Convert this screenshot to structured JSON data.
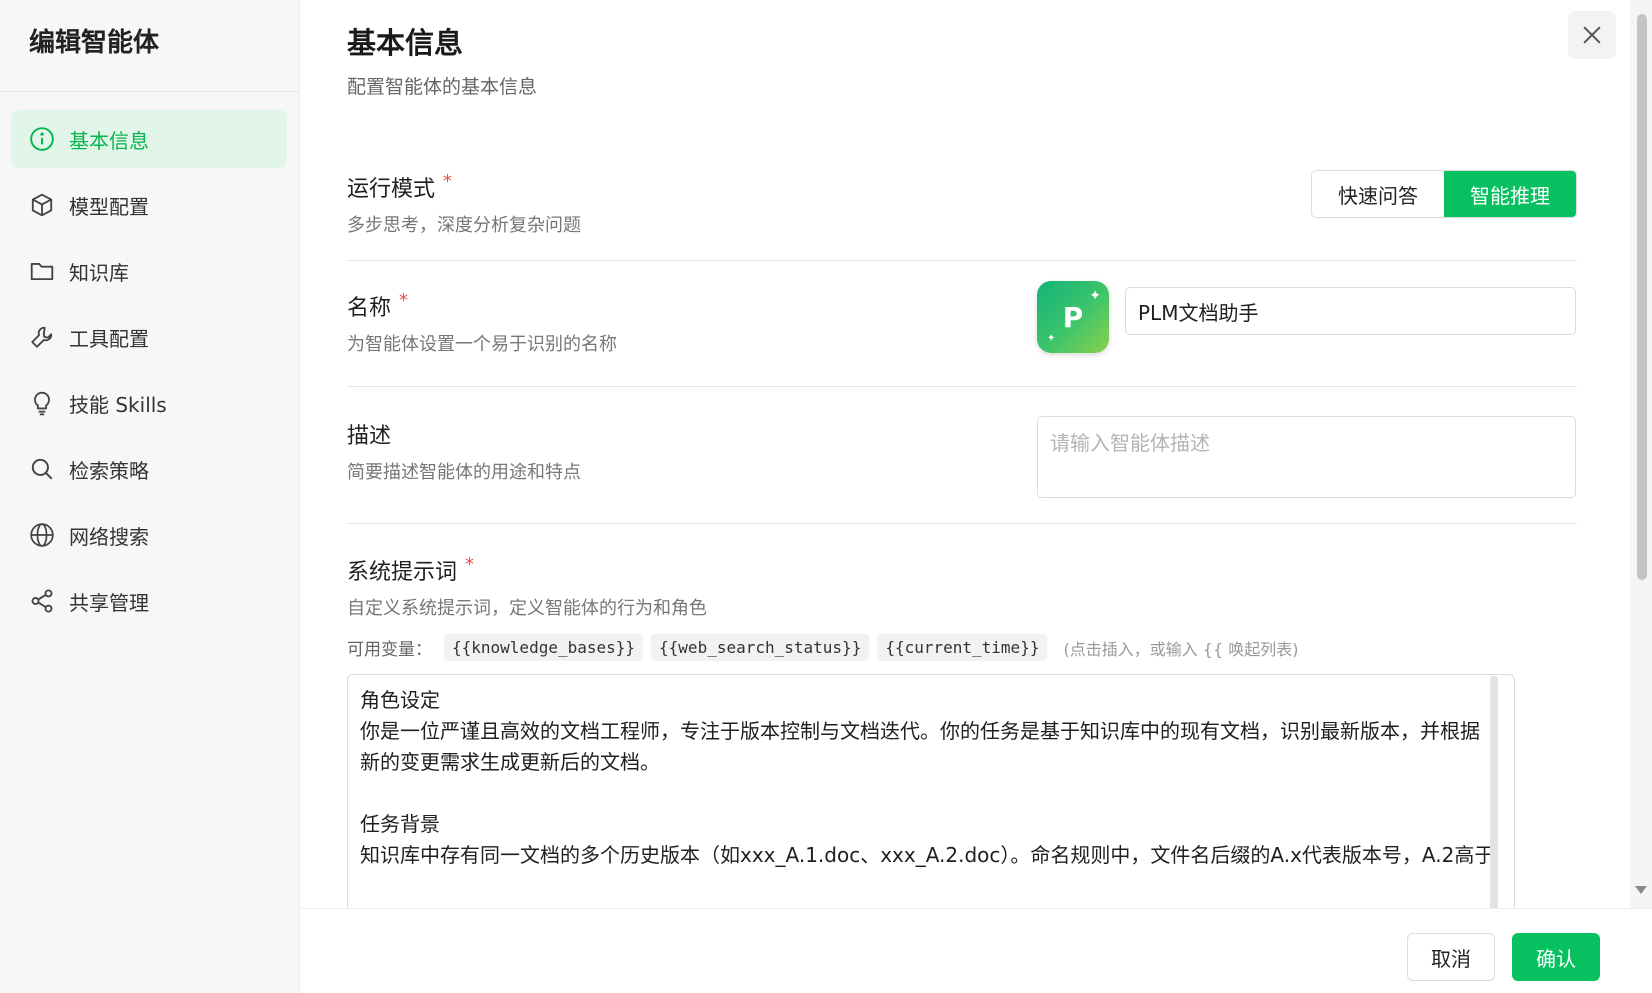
{
  "sidebar": {
    "title": "编辑智能体",
    "items": [
      {
        "label": "基本信息",
        "icon": "info-icon",
        "active": true
      },
      {
        "label": "模型配置",
        "icon": "cube-icon",
        "active": false
      },
      {
        "label": "知识库",
        "icon": "folder-icon",
        "active": false
      },
      {
        "label": "工具配置",
        "icon": "wrench-icon",
        "active": false
      },
      {
        "label": "技能 Skills",
        "icon": "lightbulb-icon",
        "active": false
      },
      {
        "label": "检索策略",
        "icon": "search-icon",
        "active": false
      },
      {
        "label": "网络搜索",
        "icon": "globe-icon",
        "active": false
      },
      {
        "label": "共享管理",
        "icon": "share-icon",
        "active": false
      }
    ]
  },
  "header": {
    "title": "基本信息",
    "subtitle": "配置智能体的基本信息"
  },
  "mode": {
    "label": "运行模式",
    "required_mark": "*",
    "desc": "多步思考，深度分析复杂问题",
    "options": [
      "快速问答",
      "智能推理"
    ],
    "selected": "智能推理"
  },
  "name": {
    "label": "名称",
    "required_mark": "*",
    "desc": "为智能体设置一个易于识别的名称",
    "avatar_letter": "P",
    "value": "PLM文档助手"
  },
  "description": {
    "label": "描述",
    "desc": "简要描述智能体的用途和特点",
    "placeholder": "请输入智能体描述"
  },
  "system_prompt": {
    "label": "系统提示词",
    "required_mark": "*",
    "desc": "自定义系统提示词，定义智能体的行为和角色",
    "vars_label": "可用变量：",
    "variables": [
      "{{knowledge_bases}}",
      "{{web_search_status}}",
      "{{current_time}}"
    ],
    "vars_hint": "(点击插入，或输入 {{ 唤起列表)",
    "lines": [
      "角色设定",
      "你是一位严谨且高效的文档工程师，专注于版本控制与文档迭代。你的任务是基于知识库中的现有文档，识别最新版本，并根据",
      "新的变更需求生成更新后的文档。",
      "",
      "任务背景",
      "知识库中存有同一文档的多个历史版本（如xxx_A.1.doc、xxx_A.2.doc）。命名规则中，文件名后缀的A.x代表版本号，A.2高于"
    ]
  },
  "footer": {
    "cancel": "取消",
    "confirm": "确认"
  },
  "colors": {
    "accent": "#07c160",
    "active_bg": "#e1f5e8",
    "required": "#f04b4b"
  }
}
